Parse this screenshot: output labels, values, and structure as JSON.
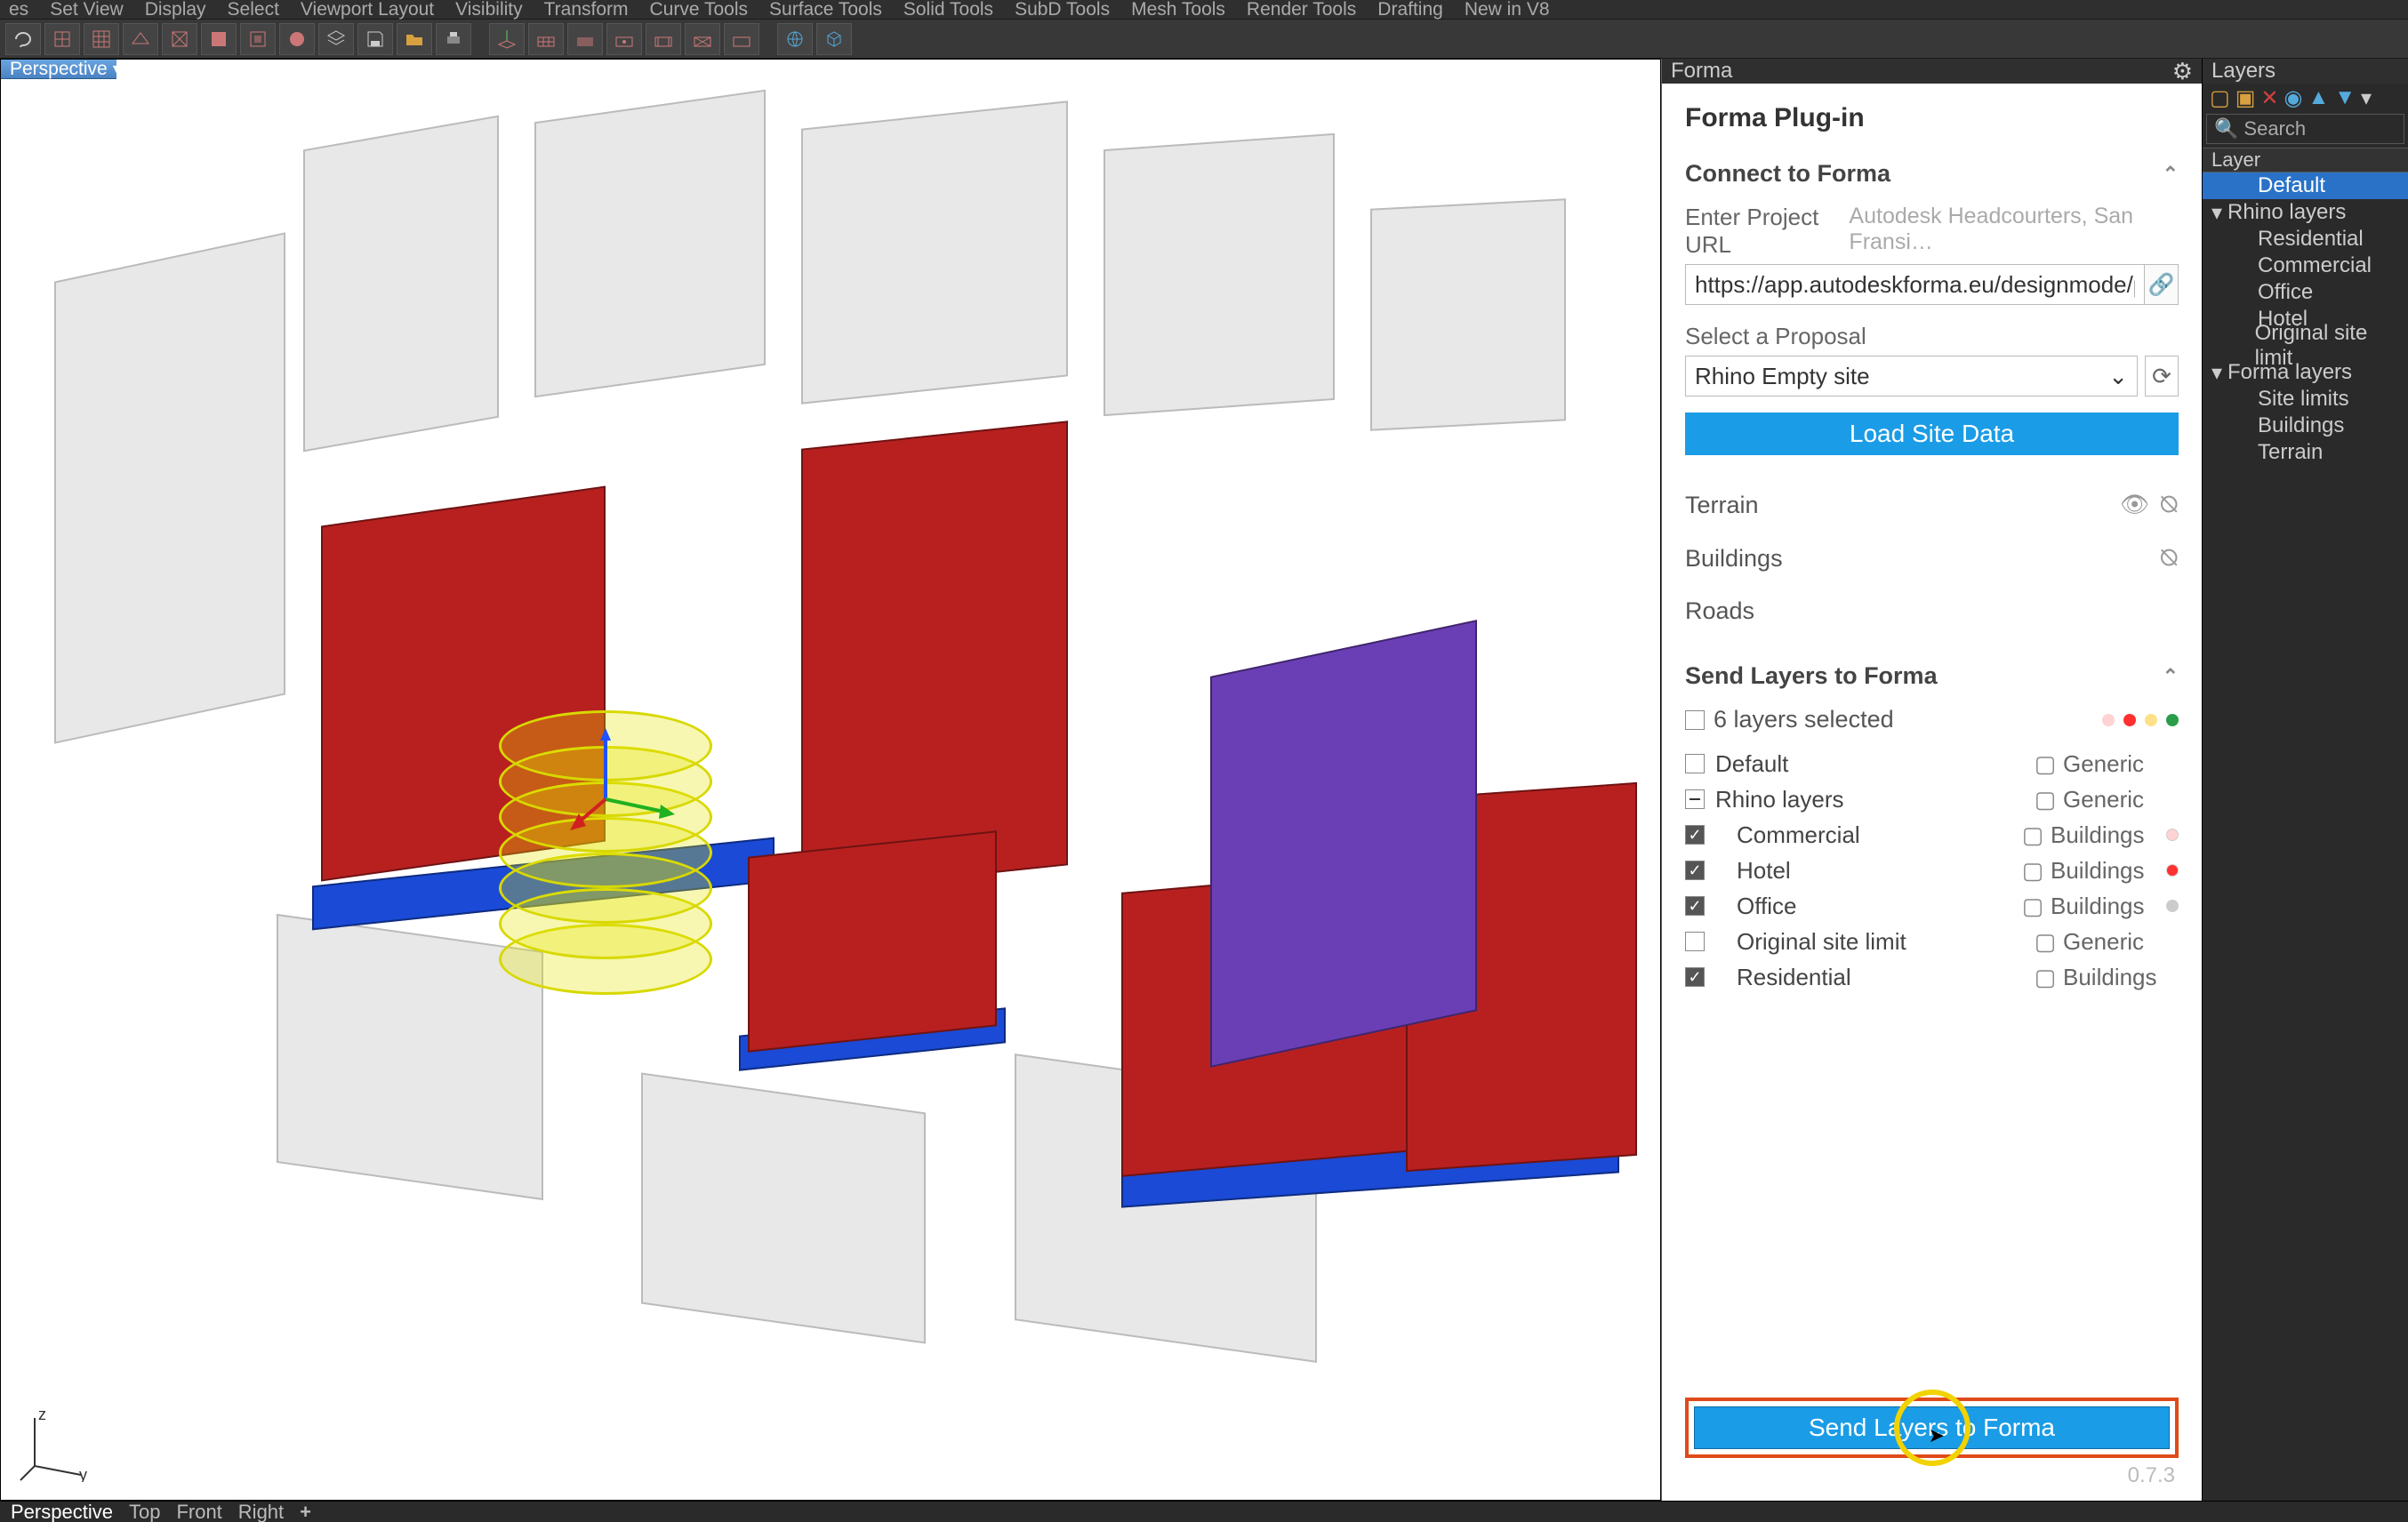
{
  "menubar": [
    "es",
    "Set View",
    "Display",
    "Select",
    "Viewport Layout",
    "Visibility",
    "Transform",
    "Curve Tools",
    "Surface Tools",
    "Solid Tools",
    "SubD Tools",
    "Mesh Tools",
    "Render Tools",
    "Drafting",
    "New in V8"
  ],
  "viewport": {
    "name": "Perspective"
  },
  "forma_tab": "Forma",
  "plugin": {
    "title": "Forma Plug-in",
    "connect_header": "Connect to Forma",
    "url_label": "Enter Project URL",
    "url_hint": "Autodesk Headcourters, San Fransi…",
    "url_value": "https://app.autodeskforma.eu/designmode/pro_ivq…",
    "proposal_label": "Select a Proposal",
    "proposal_value": "Rhino Empty site",
    "load_btn": "Load Site Data",
    "terrain": "Terrain",
    "buildings": "Buildings",
    "roads": "Roads",
    "send_header": "Send Layers to Forma",
    "selected_count": "6 layers selected",
    "layers": [
      {
        "name": "Default",
        "checked": false,
        "mixed": false,
        "type": "Generic",
        "indent": false,
        "swatch": null
      },
      {
        "name": "Rhino layers",
        "checked": false,
        "mixed": true,
        "type": "Generic",
        "indent": false,
        "swatch": null
      },
      {
        "name": "Commercial",
        "checked": true,
        "mixed": false,
        "type": "Buildings",
        "indent": true,
        "swatch": "#ffd3d3"
      },
      {
        "name": "Hotel",
        "checked": true,
        "mixed": false,
        "type": "Buildings",
        "indent": true,
        "swatch": "#ff3030"
      },
      {
        "name": "Office",
        "checked": true,
        "mixed": false,
        "type": "Buildings",
        "indent": true,
        "swatch": "#cccccc"
      },
      {
        "name": "Original site limit",
        "checked": false,
        "mixed": false,
        "type": "Generic",
        "indent": true,
        "swatch": null
      },
      {
        "name": "Residential",
        "checked": true,
        "mixed": false,
        "type": "Buildings",
        "indent": true,
        "swatch": null
      }
    ],
    "send_btn": "Send Layers to Forma",
    "version": "0.7.3"
  },
  "layers_panel": {
    "tab": "Layers",
    "search_placeholder": "Search",
    "col": "Layer",
    "tree": [
      {
        "label": "Default",
        "depth": 1,
        "sel": true,
        "tri": ""
      },
      {
        "label": "Rhino layers",
        "depth": 0,
        "sel": false,
        "tri": "▾"
      },
      {
        "label": "Residential",
        "depth": 1,
        "sel": false,
        "tri": ""
      },
      {
        "label": "Commercial",
        "depth": 1,
        "sel": false,
        "tri": ""
      },
      {
        "label": "Office",
        "depth": 1,
        "sel": false,
        "tri": ""
      },
      {
        "label": "Hotel",
        "depth": 1,
        "sel": false,
        "tri": ""
      },
      {
        "label": "Original site limit",
        "depth": 1,
        "sel": false,
        "tri": ""
      },
      {
        "label": "Forma layers",
        "depth": 0,
        "sel": false,
        "tri": "▾"
      },
      {
        "label": "Site limits",
        "depth": 1,
        "sel": false,
        "tri": ""
      },
      {
        "label": "Buildings",
        "depth": 1,
        "sel": false,
        "tri": ""
      },
      {
        "label": "Terrain",
        "depth": 1,
        "sel": false,
        "tri": ""
      }
    ]
  },
  "bottom_tabs": [
    "Perspective",
    "Top",
    "Front",
    "Right"
  ],
  "axis": {
    "z": "z",
    "y": "y"
  },
  "dot_colors": [
    "#ffd3d3",
    "#ff3030",
    "#ffe08a",
    "#2a9d4a"
  ]
}
